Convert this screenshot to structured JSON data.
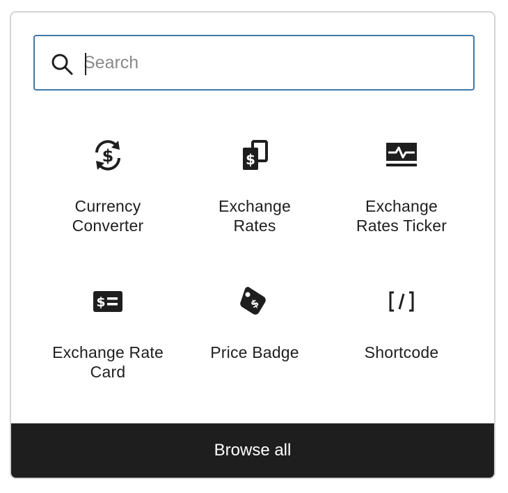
{
  "search": {
    "placeholder": "Search",
    "value": ""
  },
  "blocks": [
    {
      "label": "Currency\nConverter",
      "icon": "currency-exchange-icon"
    },
    {
      "label": "Exchange\nRates",
      "icon": "stacked-dollar-bills-icon"
    },
    {
      "label": "Exchange\nRates Ticker",
      "icon": "pulse-monitor-icon"
    },
    {
      "label": "Exchange Rate\nCard",
      "icon": "dollar-card-icon"
    },
    {
      "label": "Price Badge",
      "icon": "price-tag-icon"
    },
    {
      "label": "Shortcode",
      "icon": "shortcode-icon"
    }
  ],
  "footer": {
    "browse_all_label": "Browse all"
  },
  "colors": {
    "focus_border": "#3f78a8",
    "text": "#1e1e1e",
    "footer_bg": "#1e1e1e",
    "footer_text": "#ffffff",
    "panel_border": "#d4d4d4"
  }
}
